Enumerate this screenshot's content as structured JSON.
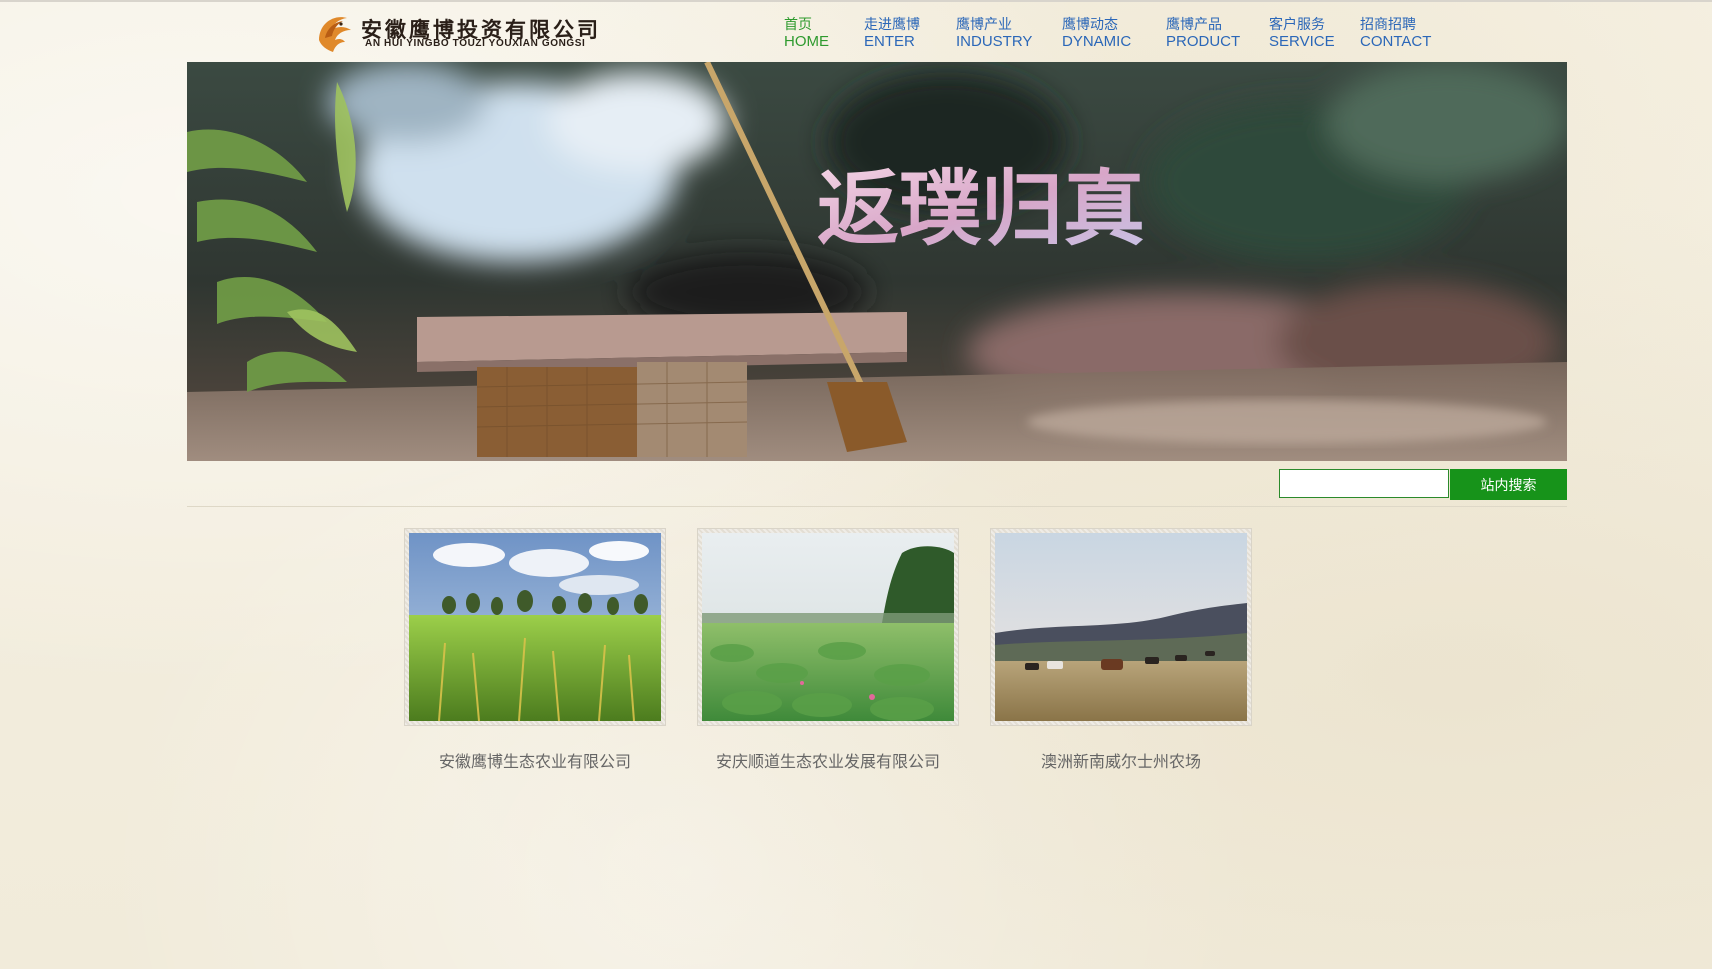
{
  "header": {
    "logo": {
      "icon": "eagle-logo-icon",
      "name_cn": "安徽鹰博投资有限公司",
      "name_en": "AN HUI YINGBO TOUZI YOUXIAN GONGSI"
    },
    "nav": [
      {
        "cn": "首页",
        "en": "HOME",
        "active": true
      },
      {
        "cn": "走进鹰博",
        "en": "ENTER",
        "active": false
      },
      {
        "cn": "鹰博产业",
        "en": "INDUSTRY",
        "active": false
      },
      {
        "cn": "鹰博动态",
        "en": "DYNAMIC",
        "active": false
      },
      {
        "cn": "鹰博产品",
        "en": "PRODUCT",
        "active": false
      },
      {
        "cn": "客户服务",
        "en": "SERVICE",
        "active": false
      },
      {
        "cn": "招商招聘",
        "en": "CONTACT",
        "active": false
      }
    ]
  },
  "banner": {
    "slogan": "返璞归真"
  },
  "search": {
    "value": "",
    "placeholder": "",
    "button_label": "站内搜索"
  },
  "cards": [
    {
      "caption": "安徽鹰博生态农业有限公司"
    },
    {
      "caption": "安庆顺道生态农业发展有限公司"
    },
    {
      "caption": "澳洲新南威尔士州农场"
    }
  ],
  "colors": {
    "nav_link": "#2b67b8",
    "nav_active": "#2e9a2e",
    "search_button": "#17931a",
    "background": "#f4efe0"
  }
}
